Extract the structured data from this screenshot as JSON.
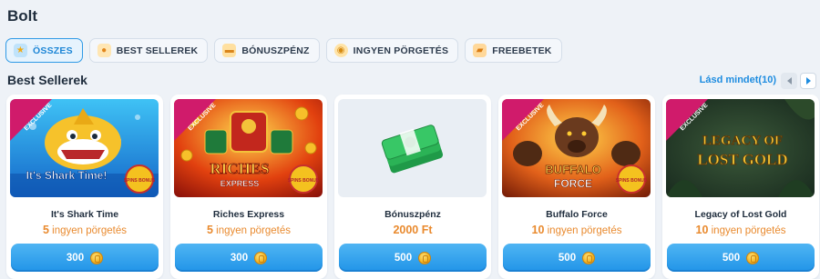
{
  "page": {
    "title": "Bolt"
  },
  "filters": [
    {
      "label": "ÖSSZES",
      "icon": "star-icon",
      "active": true
    },
    {
      "label": "BEST SELLEREK",
      "icon": "medal-icon",
      "active": false
    },
    {
      "label": "BÓNUSZPÉNZ",
      "icon": "cash-icon",
      "active": false
    },
    {
      "label": "INGYEN PÖRGETÉS",
      "icon": "spin-coin-icon",
      "active": false
    },
    {
      "label": "FREEBETEK",
      "icon": "ticket-icon",
      "active": false
    }
  ],
  "section": {
    "title": "Best Sellerek",
    "see_all": "Lásd mindet(10)"
  },
  "cards": [
    {
      "name": "It's Shark Time",
      "count": "5",
      "unit": "ingyen pörgetés",
      "price": "300",
      "ribbon": "EXCLUSIVE",
      "art_title": "It's Shark Time!",
      "badge": "SPINS BONUS"
    },
    {
      "name": "Riches Express",
      "count": "5",
      "unit": "ingyen pörgetés",
      "price": "300",
      "ribbon": "EXCLUSIVE",
      "art_title": "RICHES",
      "art_sub": "EXPRESS",
      "badge": "SPINS BONUS"
    },
    {
      "name": "Bónuszpénz",
      "amount": "2000 Ft",
      "price": "500"
    },
    {
      "name": "Buffalo Force",
      "count": "10",
      "unit": "ingyen pörgetés",
      "price": "500",
      "ribbon": "EXCLUSIVE",
      "art_title": "BUFFALO",
      "art_sub": "FORCE",
      "badge": "SPINS BONUS"
    },
    {
      "name": "Legacy of Lost Gold",
      "count": "10",
      "unit": "ingyen pörgetés",
      "price": "500",
      "ribbon": "EXCLUSIVE",
      "art_title": "LEGACY OF",
      "art_sub": "LOST GOLD"
    }
  ],
  "colors": {
    "accent": "#1d8ce0",
    "button": "#2194e8",
    "highlight": "#e98a2e"
  }
}
